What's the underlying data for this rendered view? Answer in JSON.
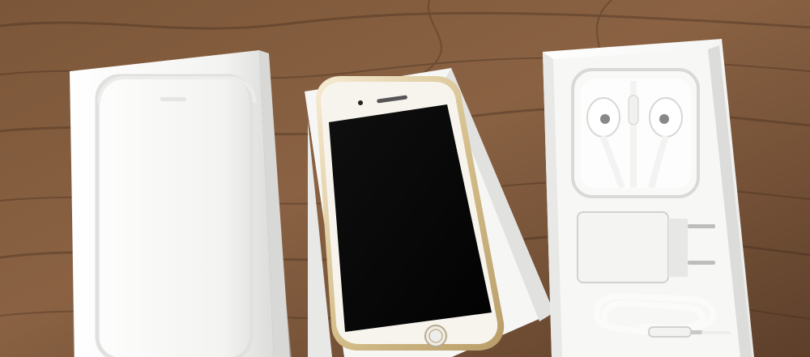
{
  "scene": {
    "objects": [
      "product-box-lid",
      "smartphone",
      "accessory-tray",
      "earphones-case",
      "power-adapter",
      "usb-cable"
    ]
  },
  "colors": {
    "wood": "#7a5538",
    "wood_dark": "#4d3222",
    "box_white": "#f2f2f0",
    "phone_screen": "#050505",
    "phone_frame": "#d8c49d"
  }
}
